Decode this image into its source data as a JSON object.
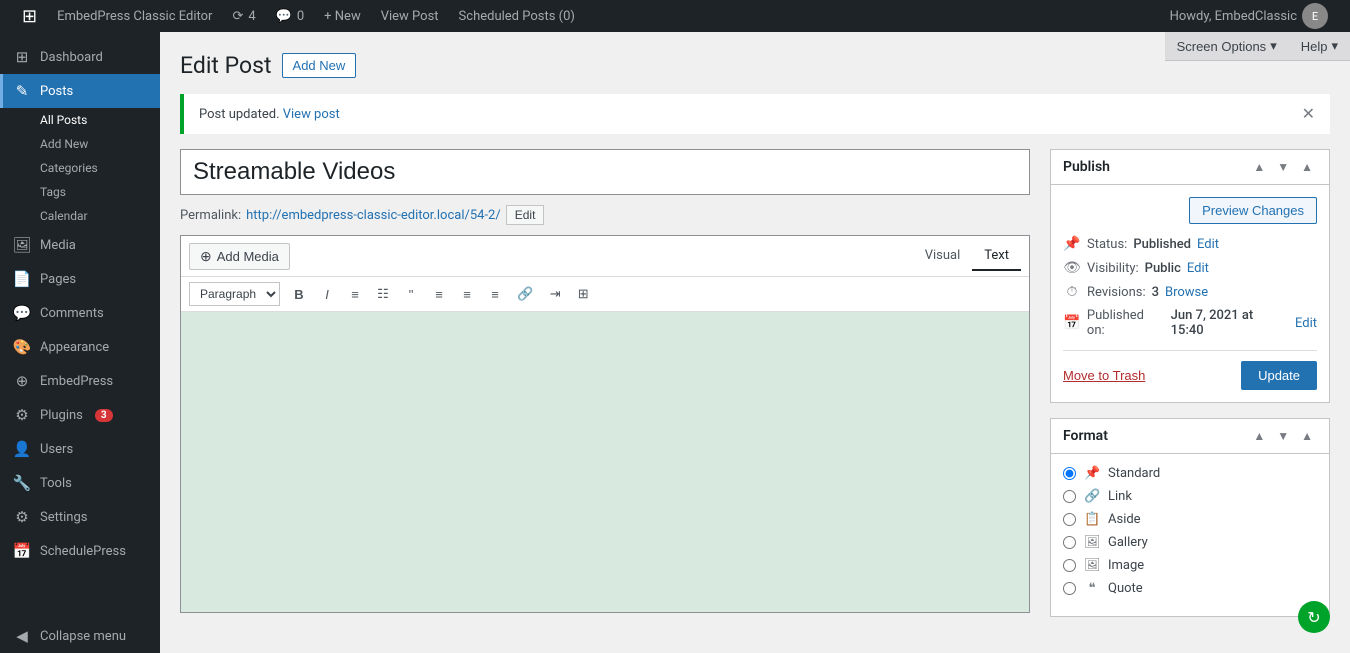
{
  "adminbar": {
    "wp_logo": "⊞",
    "site_name": "EmbedPress Classic Editor",
    "updates_count": "4",
    "comments_count": "0",
    "new_label": "+ New",
    "view_post_label": "View Post",
    "scheduled_label": "Scheduled Posts (0)",
    "user_greeting": "Howdy, EmbedClassic"
  },
  "screen_options": {
    "label": "Screen Options",
    "help_label": "Help"
  },
  "sidebar": {
    "dashboard": "Dashboard",
    "posts": "Posts",
    "all_posts": "All Posts",
    "add_new": "Add New",
    "categories": "Categories",
    "tags": "Tags",
    "calendar": "Calendar",
    "media": "Media",
    "pages": "Pages",
    "comments": "Comments",
    "appearance": "Appearance",
    "embedpress": "EmbedPress",
    "plugins": "Plugins",
    "plugins_badge": "3",
    "users": "Users",
    "tools": "Tools",
    "settings": "Settings",
    "schedulepress": "SchedulePress",
    "collapse": "Collapse menu"
  },
  "page": {
    "title": "Edit Post",
    "add_new_label": "Add New"
  },
  "notice": {
    "message": "Post updated.",
    "view_post_link": "View post",
    "view_post_text": "View post"
  },
  "post": {
    "title": "Streamable Videos",
    "permalink_label": "Permalink:",
    "permalink_url": "http://embedpress-classic-editor.local/54-2/",
    "permalink_edit": "Edit"
  },
  "editor": {
    "visual_tab": "Visual",
    "text_tab": "Text",
    "add_media_label": "Add Media",
    "paragraph_label": "Paragraph",
    "toolbar": {
      "bold": "B",
      "italic": "I",
      "ul": "☰",
      "ol": "☷",
      "blockquote": "❝",
      "align_left": "≡",
      "align_center": "≡",
      "align_right": "≡",
      "link": "🔗",
      "indent": "⇥",
      "table": "⊞"
    }
  },
  "publish_panel": {
    "title": "Publish",
    "preview_changes": "Preview Changes",
    "status_label": "Status:",
    "status_value": "Published",
    "status_edit": "Edit",
    "visibility_label": "Visibility:",
    "visibility_value": "Public",
    "visibility_edit": "Edit",
    "revisions_label": "Revisions:",
    "revisions_value": "3",
    "revisions_browse": "Browse",
    "published_label": "Published on:",
    "published_value": "Jun 7, 2021 at 15:40",
    "published_edit": "Edit",
    "move_trash": "Move to Trash",
    "update": "Update"
  },
  "format_panel": {
    "title": "Format",
    "options": [
      {
        "id": "standard",
        "label": "Standard",
        "checked": true,
        "icon": "📌"
      },
      {
        "id": "link",
        "label": "Link",
        "checked": false,
        "icon": "🔗"
      },
      {
        "id": "aside",
        "label": "Aside",
        "checked": false,
        "icon": "📋"
      },
      {
        "id": "gallery",
        "label": "Gallery",
        "checked": false,
        "icon": "🖼"
      },
      {
        "id": "image",
        "label": "Image",
        "checked": false,
        "icon": "🖼"
      },
      {
        "id": "quote",
        "label": "Quote",
        "checked": false,
        "icon": "❝"
      }
    ]
  }
}
